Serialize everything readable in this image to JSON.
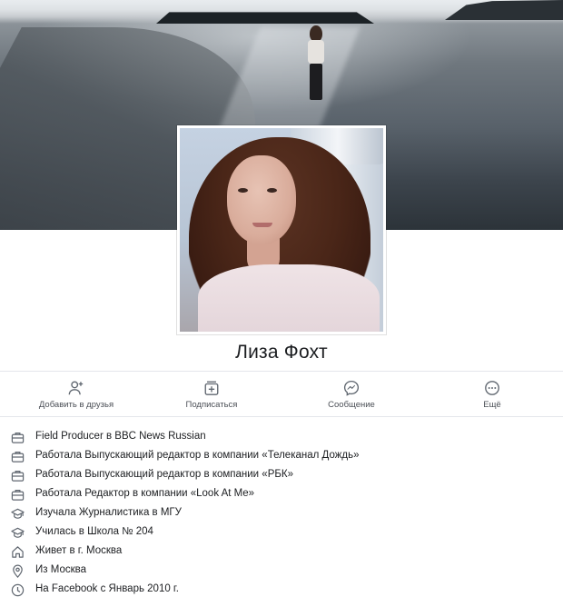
{
  "profile": {
    "name": "Лиза Фохт"
  },
  "actions": [
    {
      "label": "Добавить в друзья",
      "icon": "add-friend-icon"
    },
    {
      "label": "Подписаться",
      "icon": "subscribe-icon"
    },
    {
      "label": "Сообщение",
      "icon": "messenger-icon"
    },
    {
      "label": "Ещё",
      "icon": "more-icon"
    }
  ],
  "info": [
    {
      "text": "Field Producer в BBC News Russian",
      "icon": "briefcase-icon"
    },
    {
      "text": "Работала Выпускающий редактор в компании «Телеканал Дождь»",
      "icon": "briefcase-icon"
    },
    {
      "text": "Работала Выпускающий редактор в компании «РБК»",
      "icon": "briefcase-icon"
    },
    {
      "text": "Работала Редактор в компании «Look At Me»",
      "icon": "briefcase-icon"
    },
    {
      "text": "Изучала Журналистика в МГУ",
      "icon": "graduation-cap-icon"
    },
    {
      "text": "Училась в Школа № 204",
      "icon": "graduation-cap-icon"
    },
    {
      "text": "Живет в г. Москва",
      "icon": "home-icon"
    },
    {
      "text": "Из Москва",
      "icon": "location-pin-icon"
    },
    {
      "text": "На Facebook с Январь 2010 г.",
      "icon": "clock-icon"
    }
  ],
  "colors": {
    "text": "#1c1e21",
    "icon": "#606770",
    "divider": "#e4e6eb"
  }
}
